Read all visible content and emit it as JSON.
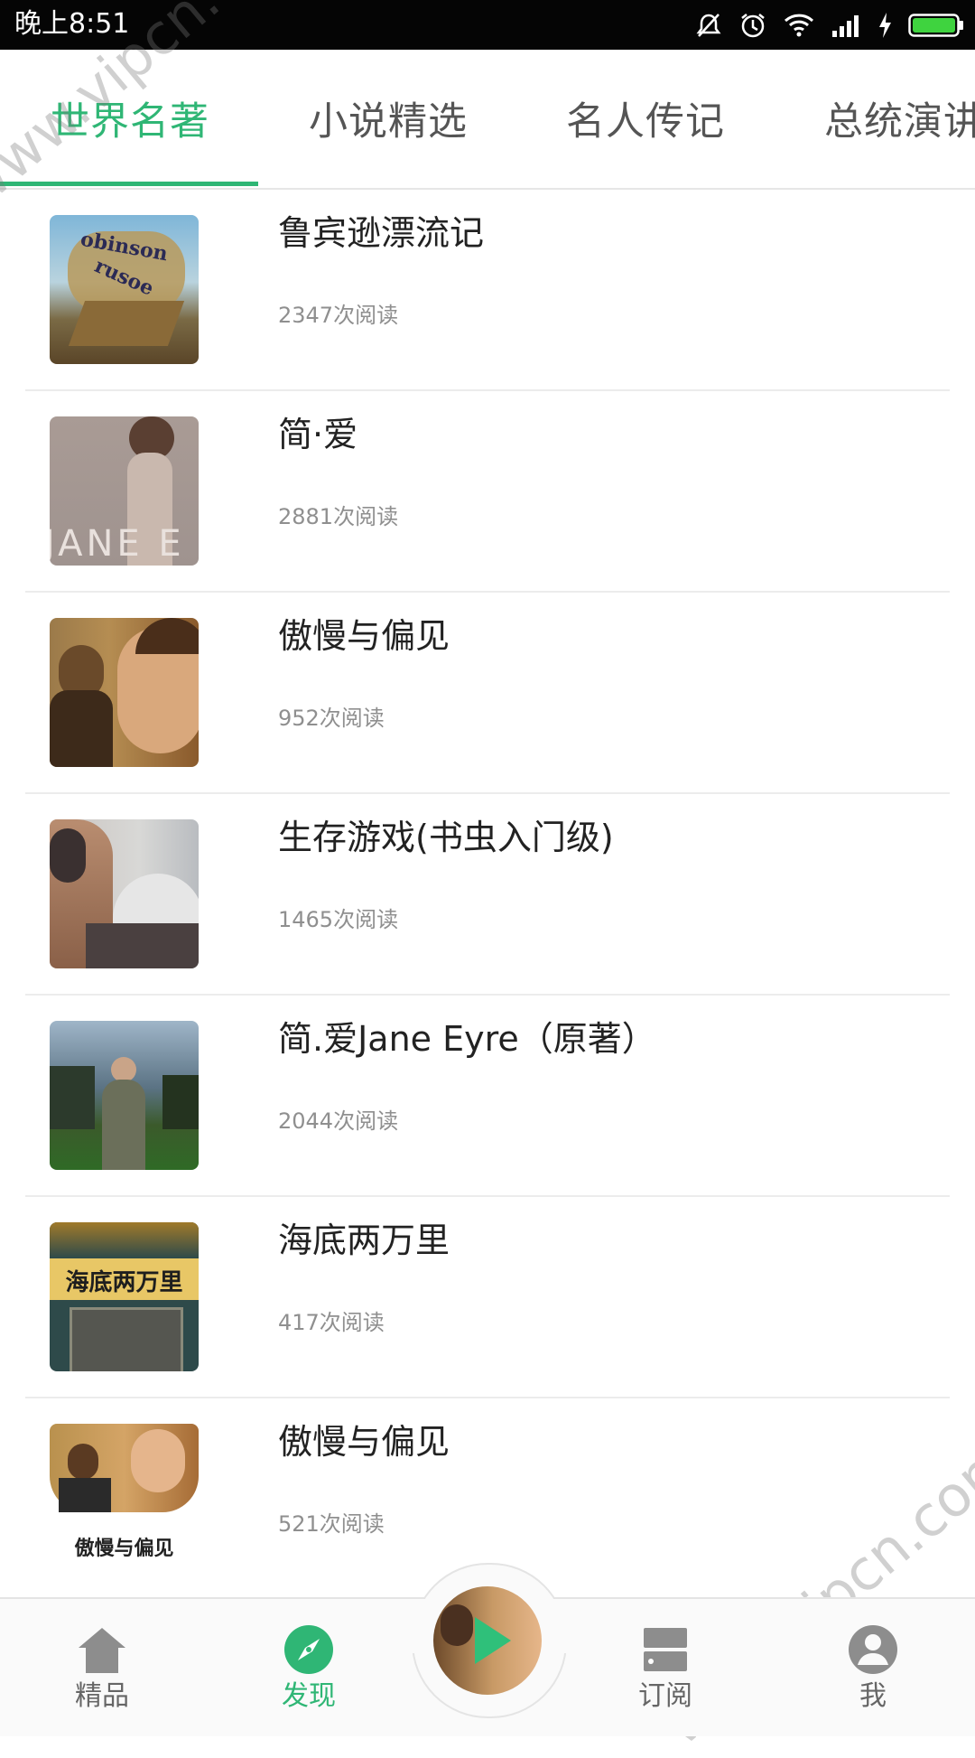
{
  "status_bar": {
    "time": "晚上8:51"
  },
  "tabs": [
    {
      "label": "世界名著"
    },
    {
      "label": "小说精选"
    },
    {
      "label": "名人传记"
    },
    {
      "label": "总统演讲"
    }
  ],
  "books": [
    {
      "title": "鲁宾逊漂流记",
      "reads": "2347次阅读"
    },
    {
      "title": "简·爱",
      "reads": "2881次阅读"
    },
    {
      "title": "傲慢与偏见",
      "reads": "952次阅读"
    },
    {
      "title": "生存游戏(书虫入门级)",
      "reads": "1465次阅读"
    },
    {
      "title": "简.爱Jane Eyre（原著）",
      "reads": "2044次阅读"
    },
    {
      "title": "海底两万里",
      "reads": "417次阅读"
    },
    {
      "title": "傲慢与偏见",
      "reads": "521次阅读"
    }
  ],
  "cover_text": {
    "robinson_1": "obinson",
    "robinson_2": "rusoe",
    "jane": "JANE E",
    "sea": "海底两万里",
    "pride": "傲慢与偏见"
  },
  "bottom_nav": [
    {
      "label": "精品",
      "icon": "home-icon"
    },
    {
      "label": "发现",
      "icon": "compass-icon"
    },
    {
      "label": "订阅",
      "icon": "list-icon"
    },
    {
      "label": "我",
      "icon": "person-icon"
    }
  ],
  "watermark": "www.vipcn.com",
  "colors": {
    "accent": "#2fb675",
    "status_bar": "#050505"
  }
}
